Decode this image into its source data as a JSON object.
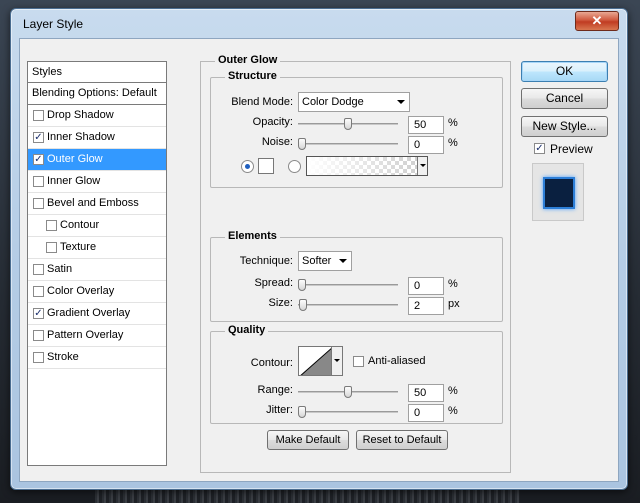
{
  "dialog": {
    "title": "Layer Style",
    "close_glyph": "✕"
  },
  "styles": {
    "header": "Styles",
    "blending": "Blending Options: Default",
    "items": [
      {
        "label": "Drop Shadow",
        "checked": false,
        "indent": false,
        "selected": false
      },
      {
        "label": "Inner Shadow",
        "checked": true,
        "indent": false,
        "selected": false
      },
      {
        "label": "Outer Glow",
        "checked": true,
        "indent": false,
        "selected": true
      },
      {
        "label": "Inner Glow",
        "checked": false,
        "indent": false,
        "selected": false
      },
      {
        "label": "Bevel and Emboss",
        "checked": false,
        "indent": false,
        "selected": false
      },
      {
        "label": "Contour",
        "checked": false,
        "indent": true,
        "selected": false
      },
      {
        "label": "Texture",
        "checked": false,
        "indent": true,
        "selected": false
      },
      {
        "label": "Satin",
        "checked": false,
        "indent": false,
        "selected": false
      },
      {
        "label": "Color Overlay",
        "checked": false,
        "indent": false,
        "selected": false
      },
      {
        "label": "Gradient Overlay",
        "checked": true,
        "indent": false,
        "selected": false
      },
      {
        "label": "Pattern Overlay",
        "checked": false,
        "indent": false,
        "selected": false
      },
      {
        "label": "Stroke",
        "checked": false,
        "indent": false,
        "selected": false
      }
    ]
  },
  "outer_glow": {
    "title": "Outer Glow",
    "structure": {
      "title": "Structure",
      "blend_mode_label": "Blend Mode:",
      "blend_mode_value": "Color Dodge",
      "opacity_label": "Opacity:",
      "opacity_value": "50",
      "opacity_level": 0.5,
      "noise_label": "Noise:",
      "noise_value": "0",
      "noise_level": 0,
      "percent": "%"
    },
    "elements": {
      "title": "Elements",
      "technique_label": "Technique:",
      "technique_value": "Softer",
      "spread_label": "Spread:",
      "spread_value": "0",
      "spread_level": 0,
      "size_label": "Size:",
      "size_value": "2",
      "size_level": 0.01,
      "percent": "%",
      "px": "px"
    },
    "quality": {
      "title": "Quality",
      "contour_label": "Contour:",
      "anti_aliased_label": "Anti-aliased",
      "anti_aliased_checked": false,
      "range_label": "Range:",
      "range_value": "50",
      "range_level": 0.5,
      "jitter_label": "Jitter:",
      "jitter_value": "0",
      "jitter_level": 0,
      "percent": "%"
    },
    "make_default": "Make Default",
    "reset_default": "Reset to Default"
  },
  "buttons": {
    "ok": "OK",
    "cancel": "Cancel",
    "new_style": "New Style...",
    "preview_label": "Preview",
    "preview_checked": true
  }
}
